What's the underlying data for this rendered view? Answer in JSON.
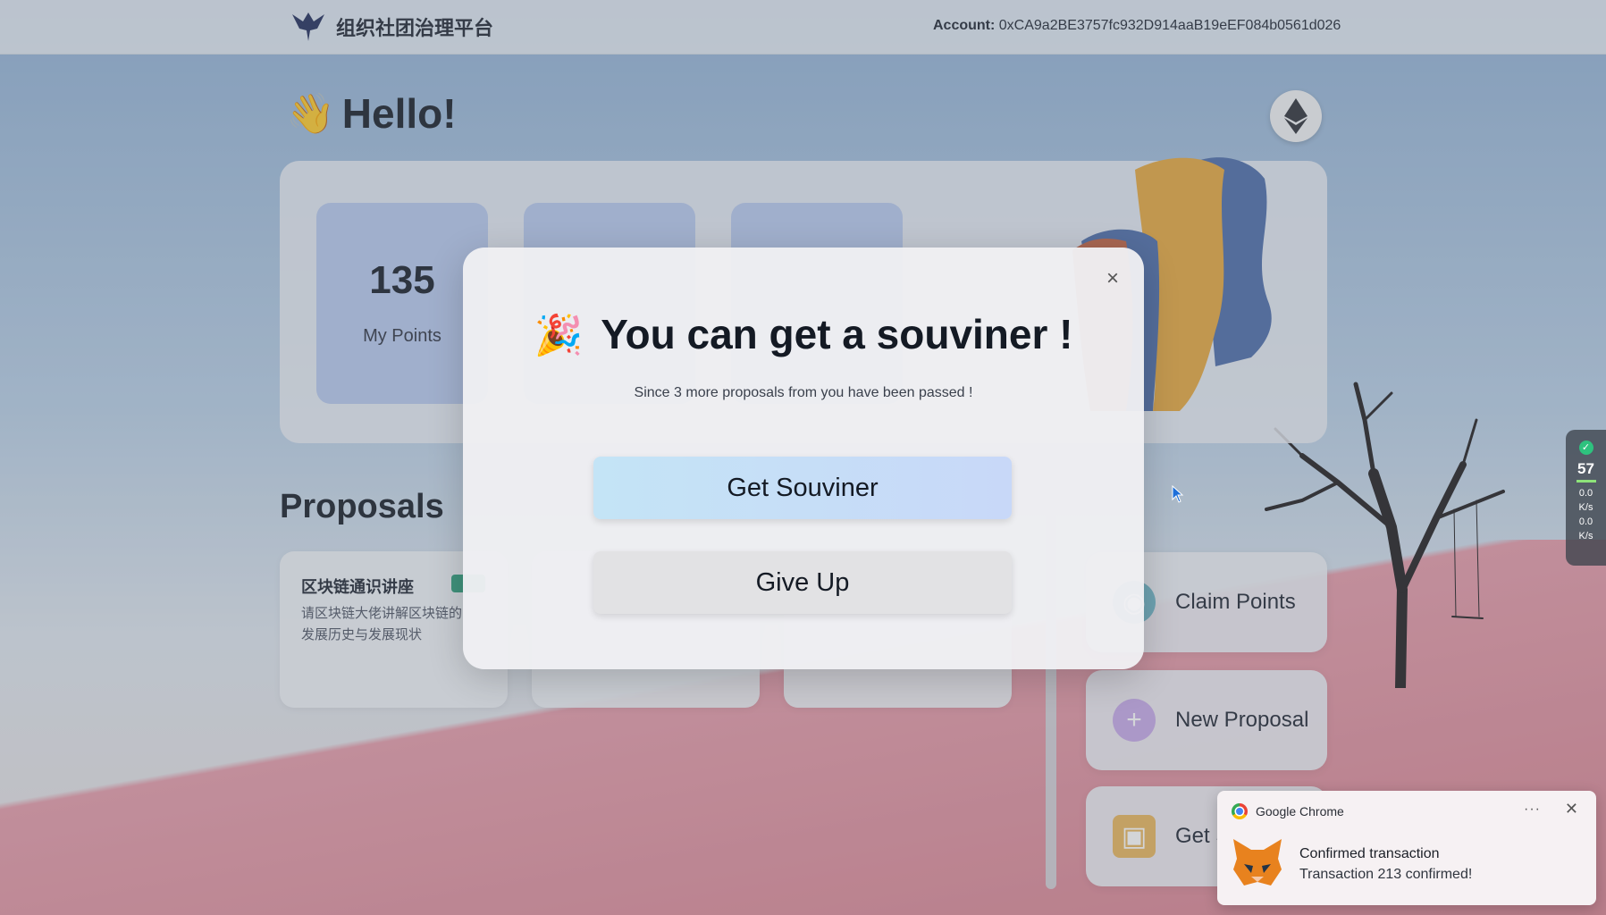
{
  "header": {
    "brand": "组织社团治理平台",
    "account_label": "Account:",
    "account_value": "0xCA9a2BE3757fc932D914aaB19eEF084b0561d026"
  },
  "hero": {
    "greeting": "Hello!",
    "greeting_emoji": "👋"
  },
  "stats": [
    {
      "value": "135",
      "label": "My Points"
    }
  ],
  "proposals": {
    "title": "Proposals",
    "items": [
      {
        "title": "区块链通识讲座",
        "desc": "请区块链大佬讲解区块链的发展历史与发展现状",
        "tag_color": "#2b9e7a"
      }
    ]
  },
  "actions": [
    {
      "label": "Claim Points",
      "icon": "coin-icon"
    },
    {
      "label": "New Proposal",
      "icon": "plus-icon"
    },
    {
      "label": "Get S",
      "icon": "gift-icon"
    }
  ],
  "modal": {
    "emoji": "🎉",
    "title": "You can get a souviner !",
    "subtitle": "Since 3 more proposals from you have been passed !",
    "primary_label": "Get Souviner",
    "secondary_label": "Give Up",
    "close_glyph": "×"
  },
  "side_widget": {
    "percent": "57",
    "up_rate": "0.0",
    "down_rate": "0.0",
    "unit": "K/s"
  },
  "toast": {
    "app": "Google Chrome",
    "more_glyph": "···",
    "close_glyph": "✕",
    "title": "Confirmed transaction",
    "message": "Transaction 213 confirmed!"
  },
  "colors": {
    "accent_primary_button": "#c4e4f6",
    "stat_card": "#b7c9ee",
    "tag_green": "#2b9e7a"
  }
}
